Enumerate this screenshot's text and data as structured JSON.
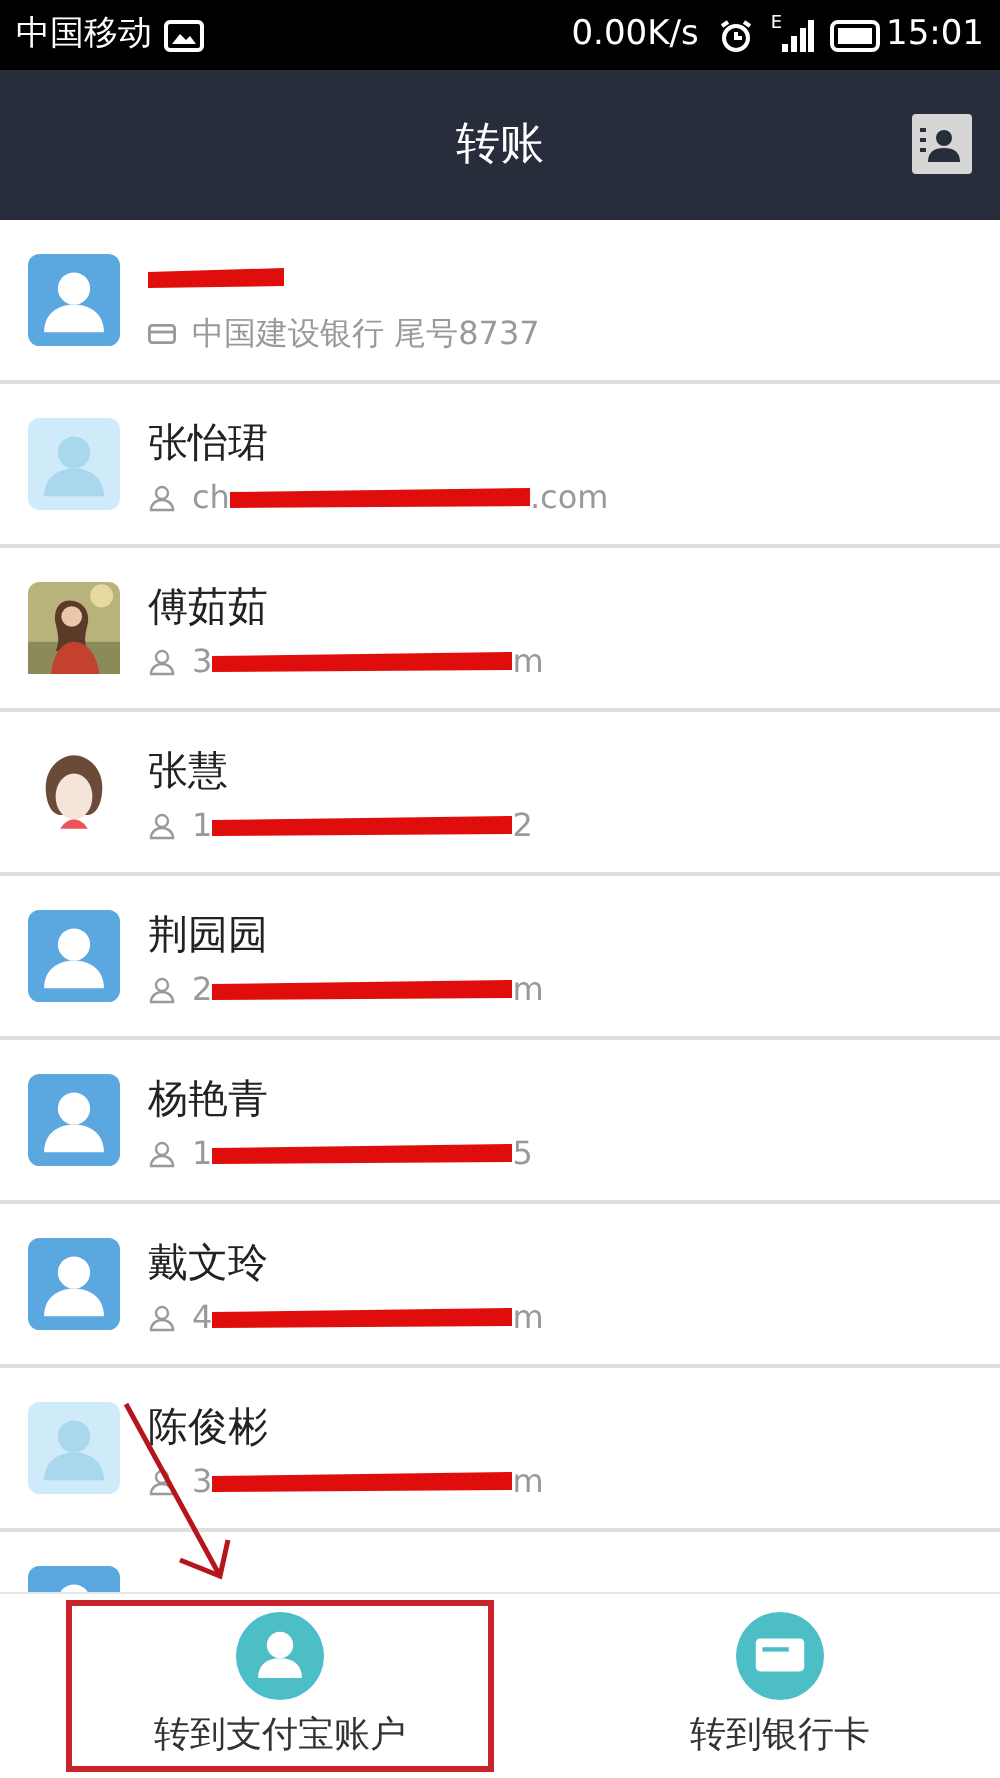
{
  "status_bar": {
    "carrier": "中国移动",
    "speed": "0.00K/s",
    "network": "E",
    "time": "15:01"
  },
  "header": {
    "title": "转账"
  },
  "contacts": [
    {
      "avatar": {
        "kind": "default"
      },
      "detail": {
        "kind": "bank",
        "prefix": "中国建设银行 尾号8737"
      },
      "redacted_name": true,
      "redacted_detail": false
    },
    {
      "avatar": {
        "kind": "faded"
      },
      "name": "张怡珺",
      "detail": {
        "kind": "account",
        "prefix": "ch",
        "suffix": ".com"
      },
      "redacted_name": false,
      "redacted_detail": true
    },
    {
      "name": "傅茹茹",
      "detail": {
        "kind": "account",
        "prefix": "3",
        "suffix": "m"
      },
      "redacted_name": false,
      "redacted_detail": true
    },
    {
      "avatar": {
        "kind": "drawing"
      },
      "name": "张慧",
      "detail": {
        "kind": "account",
        "prefix": "1",
        "suffix": "2"
      },
      "redacted_name": false,
      "redacted_detail": true
    },
    {
      "avatar": {
        "kind": "default"
      },
      "name": "荆园园",
      "detail": {
        "kind": "account",
        "prefix": "2",
        "suffix": "m"
      },
      "redacted_name": false,
      "redacted_detail": true
    },
    {
      "avatar": {
        "kind": "default"
      },
      "name": "杨艳青",
      "detail": {
        "kind": "account",
        "prefix": "1",
        "suffix": "5"
      },
      "redacted_name": false,
      "redacted_detail": true
    },
    {
      "avatar": {
        "kind": "default"
      },
      "name": "戴文玲",
      "detail": {
        "kind": "account",
        "prefix": "4",
        "suffix": "m"
      },
      "redacted_name": false,
      "redacted_detail": true
    },
    {
      "avatar": {
        "kind": "faded"
      },
      "name": "陈俊彬",
      "detail": {
        "kind": "account",
        "prefix": "3",
        "suffix": "m"
      },
      "redacted_name": false,
      "redacted_detail": true
    },
    {
      "avatar": {
        "kind": "default"
      }
    }
  ],
  "bottom_actions": [
    {
      "kind": "account",
      "label": "转到支付宝账户",
      "highlighted": true
    },
    {
      "kind": "card",
      "label": "转到银行卡",
      "highlighted": false
    }
  ]
}
